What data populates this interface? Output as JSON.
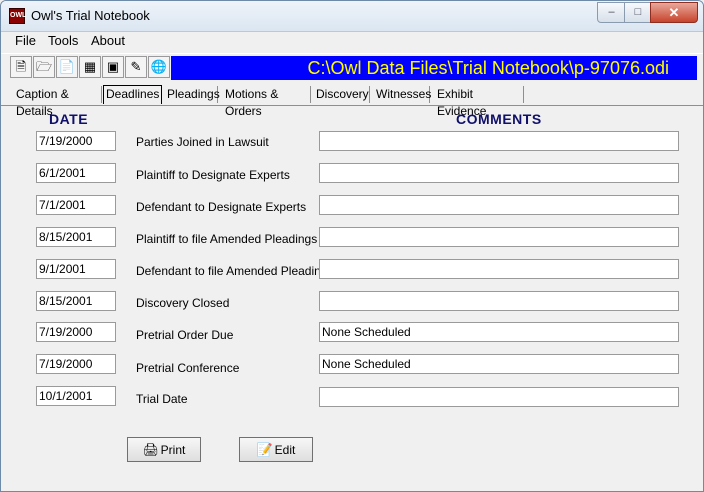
{
  "window": {
    "title": "Owl's Trial Notebook",
    "icon_text": "OWL"
  },
  "menu": [
    "File",
    "Tools",
    "About"
  ],
  "toolbar": {
    "icons": [
      "new-file-icon",
      "open-folder-icon",
      "document-icon",
      "calendar-icon",
      "calculator-icon",
      "pen-icon",
      "globe-icon"
    ],
    "path": "C:\\Owl Data Files\\Trial Notebook\\p-97076.odi",
    "banner_color": "#0000ff",
    "banner_text_color": "#ffff00"
  },
  "tabs": [
    "Caption & Details",
    "Deadlines",
    "Pleadings",
    "Motions & Orders",
    "Discovery",
    "Witnesses",
    "Exhibit Evidence"
  ],
  "active_tab": "Deadlines",
  "headers": {
    "date": "DATE",
    "comments": "COMMENTS"
  },
  "deadlines": [
    {
      "date": "7/19/2000",
      "label": "Parties Joined in Lawsuit",
      "comment": ""
    },
    {
      "date": "6/1/2001",
      "label": "Plaintiff to Designate Experts",
      "comment": ""
    },
    {
      "date": "7/1/2001",
      "label": "Defendant to Designate Experts",
      "comment": ""
    },
    {
      "date": "8/15/2001",
      "label": "Plaintiff to file Amended Pleadings",
      "comment": ""
    },
    {
      "date": "9/1/2001",
      "label": "Defendant to file Amended Pleadings",
      "comment": ""
    },
    {
      "date": "8/15/2001",
      "label": "Discovery Closed",
      "comment": ""
    },
    {
      "date": "7/19/2000",
      "label": "Pretrial Order Due",
      "comment": "None Scheduled"
    },
    {
      "date": "7/19/2000",
      "label": "Pretrial Conference",
      "comment": "None Scheduled"
    },
    {
      "date": "10/1/2001",
      "label": "Trial Date",
      "comment": ""
    }
  ],
  "buttons": {
    "print": "Print",
    "edit": "Edit"
  }
}
